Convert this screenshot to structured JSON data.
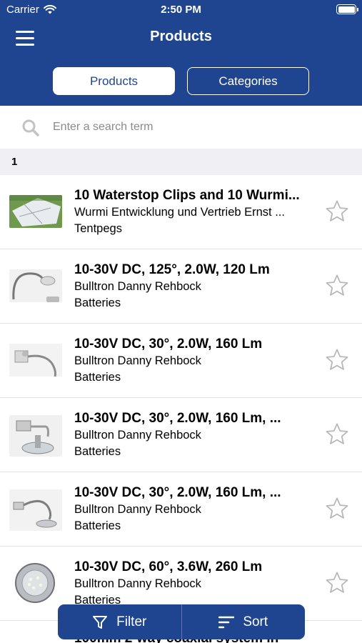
{
  "status": {
    "carrier": "Carrier",
    "time": "2:50 PM"
  },
  "nav": {
    "title": "Products"
  },
  "segments": {
    "products": "Products",
    "categories": "Categories"
  },
  "search": {
    "placeholder": "Enter a search term"
  },
  "section": {
    "header": "1"
  },
  "products": [
    {
      "title": "10 Waterstop Clips and 10 Wurmi...",
      "supplier": "Wurmi Entwicklung und Vertrieb Ernst ...",
      "category": "Tentpegs",
      "favorite": false
    },
    {
      "title": "10-30V DC, 125°, 2.0W, 120 Lm",
      "supplier": "Bulltron Danny Rehbock",
      "category": "Batteries",
      "favorite": false
    },
    {
      "title": "10-30V DC, 30°, 2.0W, 160 Lm",
      "supplier": "Bulltron Danny Rehbock",
      "category": "Batteries",
      "favorite": false
    },
    {
      "title": "10-30V DC, 30°, 2.0W, 160 Lm, ...",
      "supplier": "Bulltron Danny Rehbock",
      "category": "Batteries",
      "favorite": false
    },
    {
      "title": "10-30V DC, 30°, 2.0W, 160 Lm, ...",
      "supplier": "Bulltron Danny Rehbock",
      "category": "Batteries",
      "favorite": false
    },
    {
      "title": "10-30V DC, 60°, 3.6W, 260 Lm",
      "supplier": "Bulltron Danny Rehbock",
      "category": "Batteries",
      "favorite": false
    },
    {
      "title": "100mm 2-way coaxial system in",
      "supplier": "",
      "category": "",
      "favorite": false
    }
  ],
  "toolbar": {
    "filter": "Filter",
    "sort": "Sort"
  },
  "colors": {
    "brand": "#1f4591",
    "section_bg": "#efeff4",
    "star": "#b8b8b8"
  },
  "icons": {
    "menu": "hamburger-icon",
    "search": "search-icon",
    "favorite": "star-outline-icon",
    "filter": "funnel-icon",
    "sort": "sort-lines-icon",
    "wifi": "wifi-icon",
    "battery": "battery-icon"
  }
}
